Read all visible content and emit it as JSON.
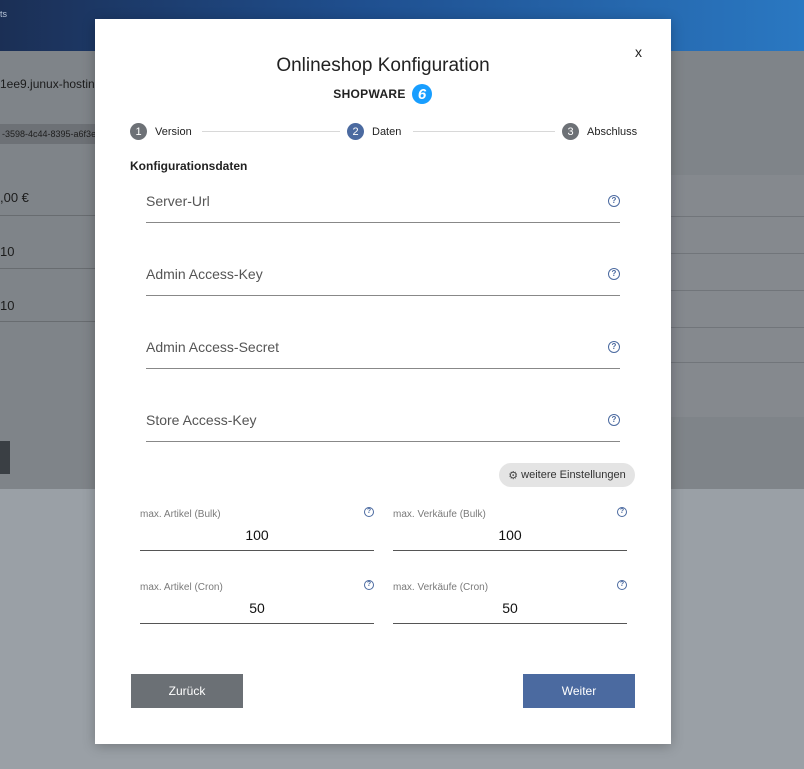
{
  "background": {
    "header_text": "ts",
    "host_text": "1ee9.junux-hostin",
    "id_chip": "-3598-4c44-8395-a6f3e",
    "price": ",00 €",
    "value_a": "10",
    "value_b": "10"
  },
  "modal": {
    "close_label": "x",
    "title": "Onlineshop Konfiguration",
    "brand_name": "SHOPWARE",
    "brand_logo_digit": "6",
    "steps": [
      {
        "number": "1",
        "label": "Version"
      },
      {
        "number": "2",
        "label": "Daten"
      },
      {
        "number": "3",
        "label": "Abschluss"
      }
    ],
    "active_step": 2,
    "section_title": "Konfigurationsdaten",
    "fields": [
      {
        "label": "Server-Url",
        "value": ""
      },
      {
        "label": "Admin Access-Key",
        "value": ""
      },
      {
        "label": "Admin Access-Secret",
        "value": ""
      },
      {
        "label": "Store Access-Key",
        "value": ""
      }
    ],
    "help_icon_glyph": "?",
    "settings_button": "weitere Einstellungen",
    "limits": [
      {
        "label": "max. Artikel (Bulk)",
        "value": "100"
      },
      {
        "label": "max. Verkäufe (Bulk)",
        "value": "100"
      },
      {
        "label": "max. Artikel (Cron)",
        "value": "50"
      },
      {
        "label": "max. Verkäufe (Cron)",
        "value": "50"
      }
    ],
    "back_button": "Zurück",
    "next_button": "Weiter"
  },
  "colors": {
    "accent": "#4b6aa0",
    "secondary_button": "#6b7075",
    "shopware_blue": "#189eff"
  }
}
